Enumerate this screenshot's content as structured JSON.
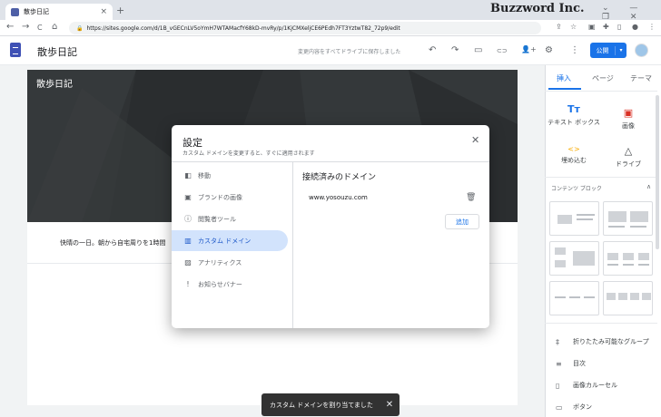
{
  "browser": {
    "tab_title": "散歩日記",
    "tab_close": "×",
    "new_tab": "+",
    "brand": "Buzzword Inc.",
    "window_controls": "⌄ — ❐ ✕",
    "url": "https://sites.google.com/d/1B_vGECnLV5oYmH7WTAMacfY68kD-mvRy/p/1KjCMXeljCE6PEdh7FT3YztwT82_72p9/edit",
    "nav_back": "←",
    "nav_forward": "→",
    "nav_reload": "C",
    "nav_home": "⌂",
    "lock": "🔒"
  },
  "header": {
    "doc_title": "散歩日記",
    "saved_status": "変更内容をすべてドライブに保存しました",
    "publish_label": "公開",
    "publish_dropdown": "▾",
    "toolbar_icons": [
      "undo-icon",
      "redo-icon",
      "preview-icon",
      "link-icon",
      "share-icon",
      "settings-icon",
      "more-icon"
    ],
    "icon_glyphs": {
      "undo": "↶",
      "redo": "↷",
      "preview": "▭",
      "link": "⊂⊃",
      "share": "👤+",
      "settings": "⚙",
      "more": "⋮"
    }
  },
  "site": {
    "hero_title": "散歩日記",
    "body_text": "快晴の一日。朝から自宅周りを1時間"
  },
  "sidebar": {
    "tabs": [
      "挿入",
      "ページ",
      "テーマ"
    ],
    "active_tab": "挿入",
    "insert_items": [
      {
        "label": "テキスト ボックス",
        "icon": "Tт"
      },
      {
        "label": "画像",
        "icon": "▣"
      },
      {
        "label": "埋め込む",
        "icon": "<>"
      },
      {
        "label": "ドライブ",
        "icon": "△"
      }
    ],
    "content_blocks_header": "コンテンツ ブロック",
    "content_blocks_chevron": "∧",
    "other_items": [
      {
        "label": "折りたたみ可能なグループ",
        "icon": "‡"
      },
      {
        "label": "目次",
        "icon": "≡"
      },
      {
        "label": "画像カルーセル",
        "icon": "▯"
      },
      {
        "label": "ボタン",
        "icon": "▭"
      }
    ]
  },
  "dialog": {
    "title": "設定",
    "subtitle": "カスタム ドメインを変更すると、すぐに適用されます",
    "close": "✕",
    "menu": [
      {
        "label": "移動",
        "icon": "◧"
      },
      {
        "label": "ブランドの画像",
        "icon": "▣"
      },
      {
        "label": "閲覧者ツール",
        "icon": "ⓘ"
      },
      {
        "label": "カスタム ドメイン",
        "icon": "▥"
      },
      {
        "label": "アナリティクス",
        "icon": "▨"
      },
      {
        "label": "お知らせバナー",
        "icon": "!"
      }
    ],
    "active_menu": "カスタム ドメイン",
    "section_title": "接続済みのドメイン",
    "domain": "www.yosouzu.com",
    "delete_icon": "🗑",
    "add_label": "追加"
  },
  "snackbar": {
    "message": "カスタム ドメインを割り当てました",
    "close": "✕"
  },
  "colors": {
    "accent": "#1a73e8",
    "active_menu_bg": "#d2e3fc",
    "hero": "#2f3234"
  }
}
